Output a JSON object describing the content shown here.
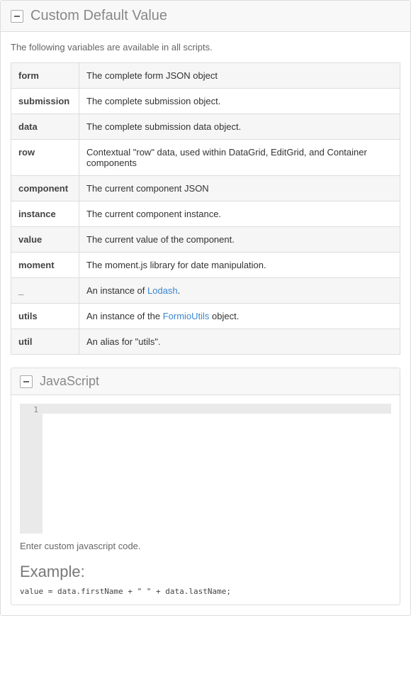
{
  "main": {
    "title": "Custom Default Value",
    "intro": "The following variables are available in all scripts.",
    "vars": [
      {
        "name": "form",
        "desc": "The complete form JSON object"
      },
      {
        "name": "submission",
        "desc": "The complete submission object."
      },
      {
        "name": "data",
        "desc": "The complete submission data object."
      },
      {
        "name": "row",
        "desc": "Contextual \"row\" data, used within DataGrid, EditGrid, and Container components"
      },
      {
        "name": "component",
        "desc": "The current component JSON"
      },
      {
        "name": "instance",
        "desc": "The current component instance."
      },
      {
        "name": "value",
        "desc": "The current value of the component."
      },
      {
        "name": "moment",
        "desc": "The moment.js library for date manipulation."
      },
      {
        "name": "_",
        "desc_prefix": "An instance of ",
        "link": "Lodash",
        "desc_suffix": "."
      },
      {
        "name": "utils",
        "desc_prefix": "An instance of the ",
        "link": "FormioUtils",
        "desc_suffix": " object."
      },
      {
        "name": "util",
        "desc": "An alias for \"utils\"."
      }
    ]
  },
  "js": {
    "title": "JavaScript",
    "line_number": "1",
    "code_value": "",
    "help": "Enter custom javascript code.",
    "example_heading": "Example:",
    "example_code": "value = data.firstName + \" \" + data.lastName;"
  }
}
